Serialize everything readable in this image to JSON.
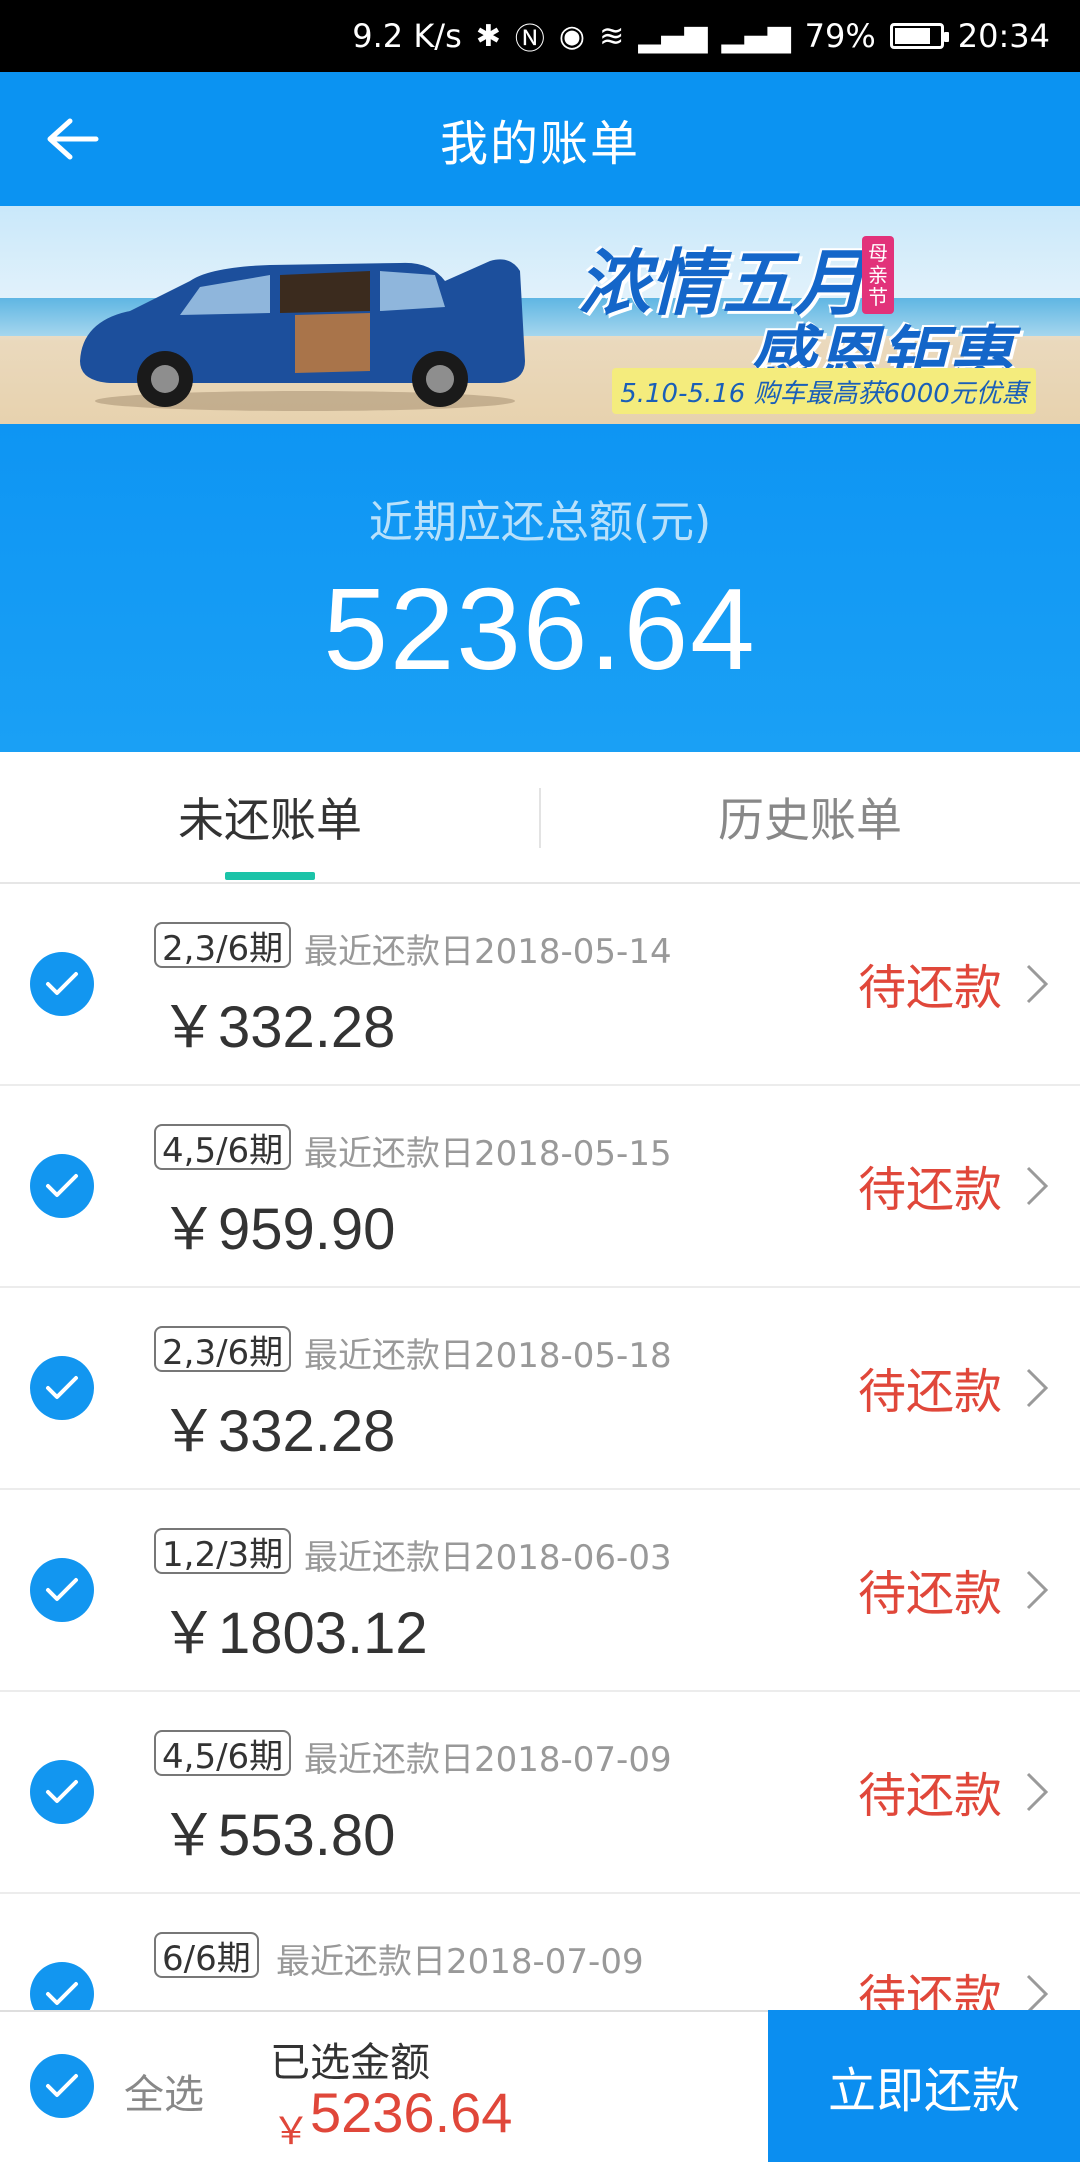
{
  "status_bar": {
    "speed": "9.2 K/s",
    "battery": "79%",
    "battery_level": 0.79,
    "time": "20:34",
    "icons": [
      "bluetooth-icon",
      "nfc-icon",
      "eye-icon",
      "wifi-icon",
      "4g-signal-icon",
      "3g-signal-icon",
      "battery-icon"
    ]
  },
  "header": {
    "title": "我的账单",
    "back_icon": "arrow-left-icon"
  },
  "banner": {
    "title_line1": "浓情五月",
    "title_line2": "感恩钜惠",
    "tag": "母亲节",
    "subtitle": "5.10-5.16 购车最高获6000元优惠"
  },
  "summary": {
    "label": "近期应还总额(元)",
    "amount": "5236.64"
  },
  "tabs": [
    {
      "label": "未还账单",
      "active": true
    },
    {
      "label": "历史账单",
      "active": false
    }
  ],
  "bills": [
    {
      "period": "2,3/6期",
      "due_label": "最近还款日2018-05-14",
      "amount": "￥332.28",
      "status": "待还款",
      "checked": true
    },
    {
      "period": "4,5/6期",
      "due_label": "最近还款日2018-05-15",
      "amount": "￥959.90",
      "status": "待还款",
      "checked": true
    },
    {
      "period": "2,3/6期",
      "due_label": "最近还款日2018-05-18",
      "amount": "￥332.28",
      "status": "待还款",
      "checked": true
    },
    {
      "period": "1,2/3期",
      "due_label": "最近还款日2018-06-03",
      "amount": "￥1803.12",
      "status": "待还款",
      "checked": true
    },
    {
      "period": "4,5/6期",
      "due_label": "最近还款日2018-07-09",
      "amount": "￥553.80",
      "status": "待还款",
      "checked": true
    },
    {
      "period": "6/6期",
      "due_label": "最近还款日2018-07-09",
      "amount": "",
      "status": "待还款",
      "checked": true
    }
  ],
  "bottom_bar": {
    "select_all": "全选",
    "selected_label": "已选金额",
    "currency": "￥",
    "selected_amount": "5236.64",
    "pay_button": "立即还款"
  },
  "colors": {
    "primary_blue": "#0b93f2",
    "tab_indicator": "#1bc3a8",
    "status_red": "#e0473a"
  }
}
